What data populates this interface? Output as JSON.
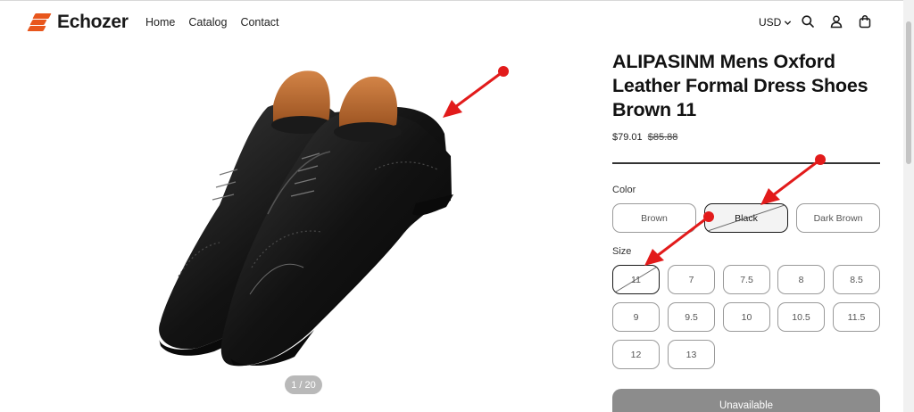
{
  "header": {
    "brand": "Echozer",
    "nav": [
      "Home",
      "Catalog",
      "Contact"
    ],
    "currency": "USD"
  },
  "gallery": {
    "pager": "1 / 20"
  },
  "product": {
    "title": "ALIPASINM Mens Oxford Leather Formal Dress Shoes Brown 11",
    "price": "$79.01",
    "compare_price": "$85.88",
    "color_label": "Color",
    "colors": [
      "Brown",
      "Black",
      "Dark Brown"
    ],
    "selected_color": "Black",
    "size_label": "Size",
    "sizes": [
      "11",
      "7",
      "7.5",
      "8",
      "8.5",
      "9",
      "9.5",
      "10",
      "10.5",
      "11.5",
      "12",
      "13"
    ],
    "selected_size": "11",
    "button_label": "Unavailable"
  },
  "colors": {
    "brand": "#e8561c",
    "annotation": "#e21b1b",
    "button_disabled": "#8c8c8c"
  },
  "icons": [
    "search-icon",
    "account-icon",
    "cart-icon",
    "chevron-down-icon"
  ]
}
